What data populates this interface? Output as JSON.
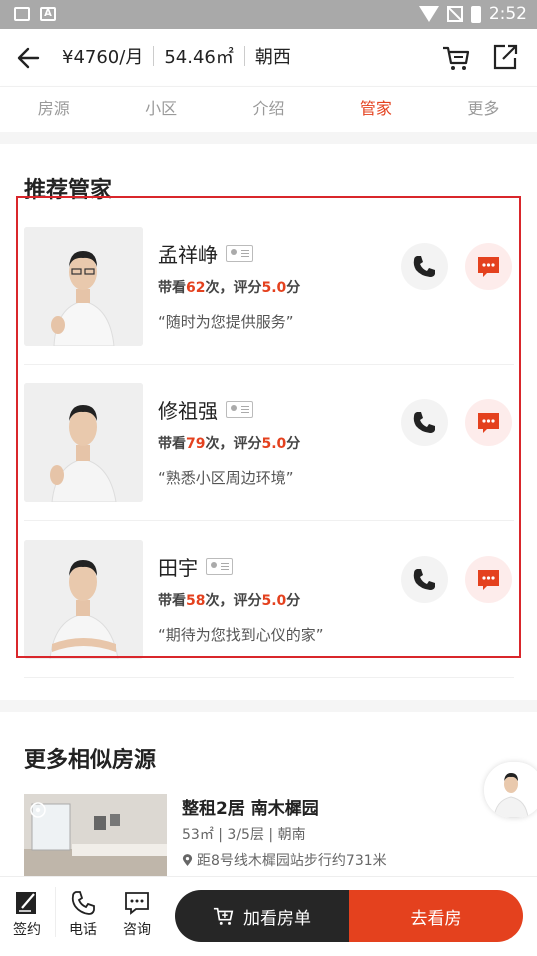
{
  "status_bar": {
    "time": "2:52"
  },
  "header": {
    "price": "¥4760/月",
    "area": "54.46㎡",
    "orientation": "朝西"
  },
  "tabs": [
    {
      "label": "房源",
      "active": false
    },
    {
      "label": "小区",
      "active": false
    },
    {
      "label": "介绍",
      "active": false
    },
    {
      "label": "管家",
      "active": true
    },
    {
      "label": "更多",
      "active": false
    }
  ],
  "managers_section": {
    "title": "推荐管家",
    "agents": [
      {
        "name": "孟祥峥",
        "stats_prefix": "带看",
        "visits": "62",
        "stats_mid": "次，评分",
        "rating": "5.0",
        "stats_suffix": "分",
        "quote": "“随时为您提供服务”"
      },
      {
        "name": "修祖强",
        "stats_prefix": "带看",
        "visits": "79",
        "stats_mid": "次，评分",
        "rating": "5.0",
        "stats_suffix": "分",
        "quote": "“熟悉小区周边环境”"
      },
      {
        "name": "田宇",
        "stats_prefix": "带看",
        "visits": "58",
        "stats_mid": "次，评分",
        "rating": "5.0",
        "stats_suffix": "分",
        "quote": "“期待为您找到心仪的家”"
      }
    ]
  },
  "similar_section": {
    "title": "更多相似房源",
    "listing": {
      "title": "整租2居 南木樨园",
      "meta": "53㎡ | 3/5层 | 朝南",
      "location": "距8号线木樨园站步行约731米"
    }
  },
  "bottom_bar": {
    "sign_label": "签约",
    "phone_label": "电话",
    "consult_label": "咨询",
    "add_label": "加看房单",
    "go_label": "去看房"
  },
  "colors": {
    "accent": "#e4411e",
    "dark_button": "#262626",
    "highlight_box": "#d9262b"
  }
}
